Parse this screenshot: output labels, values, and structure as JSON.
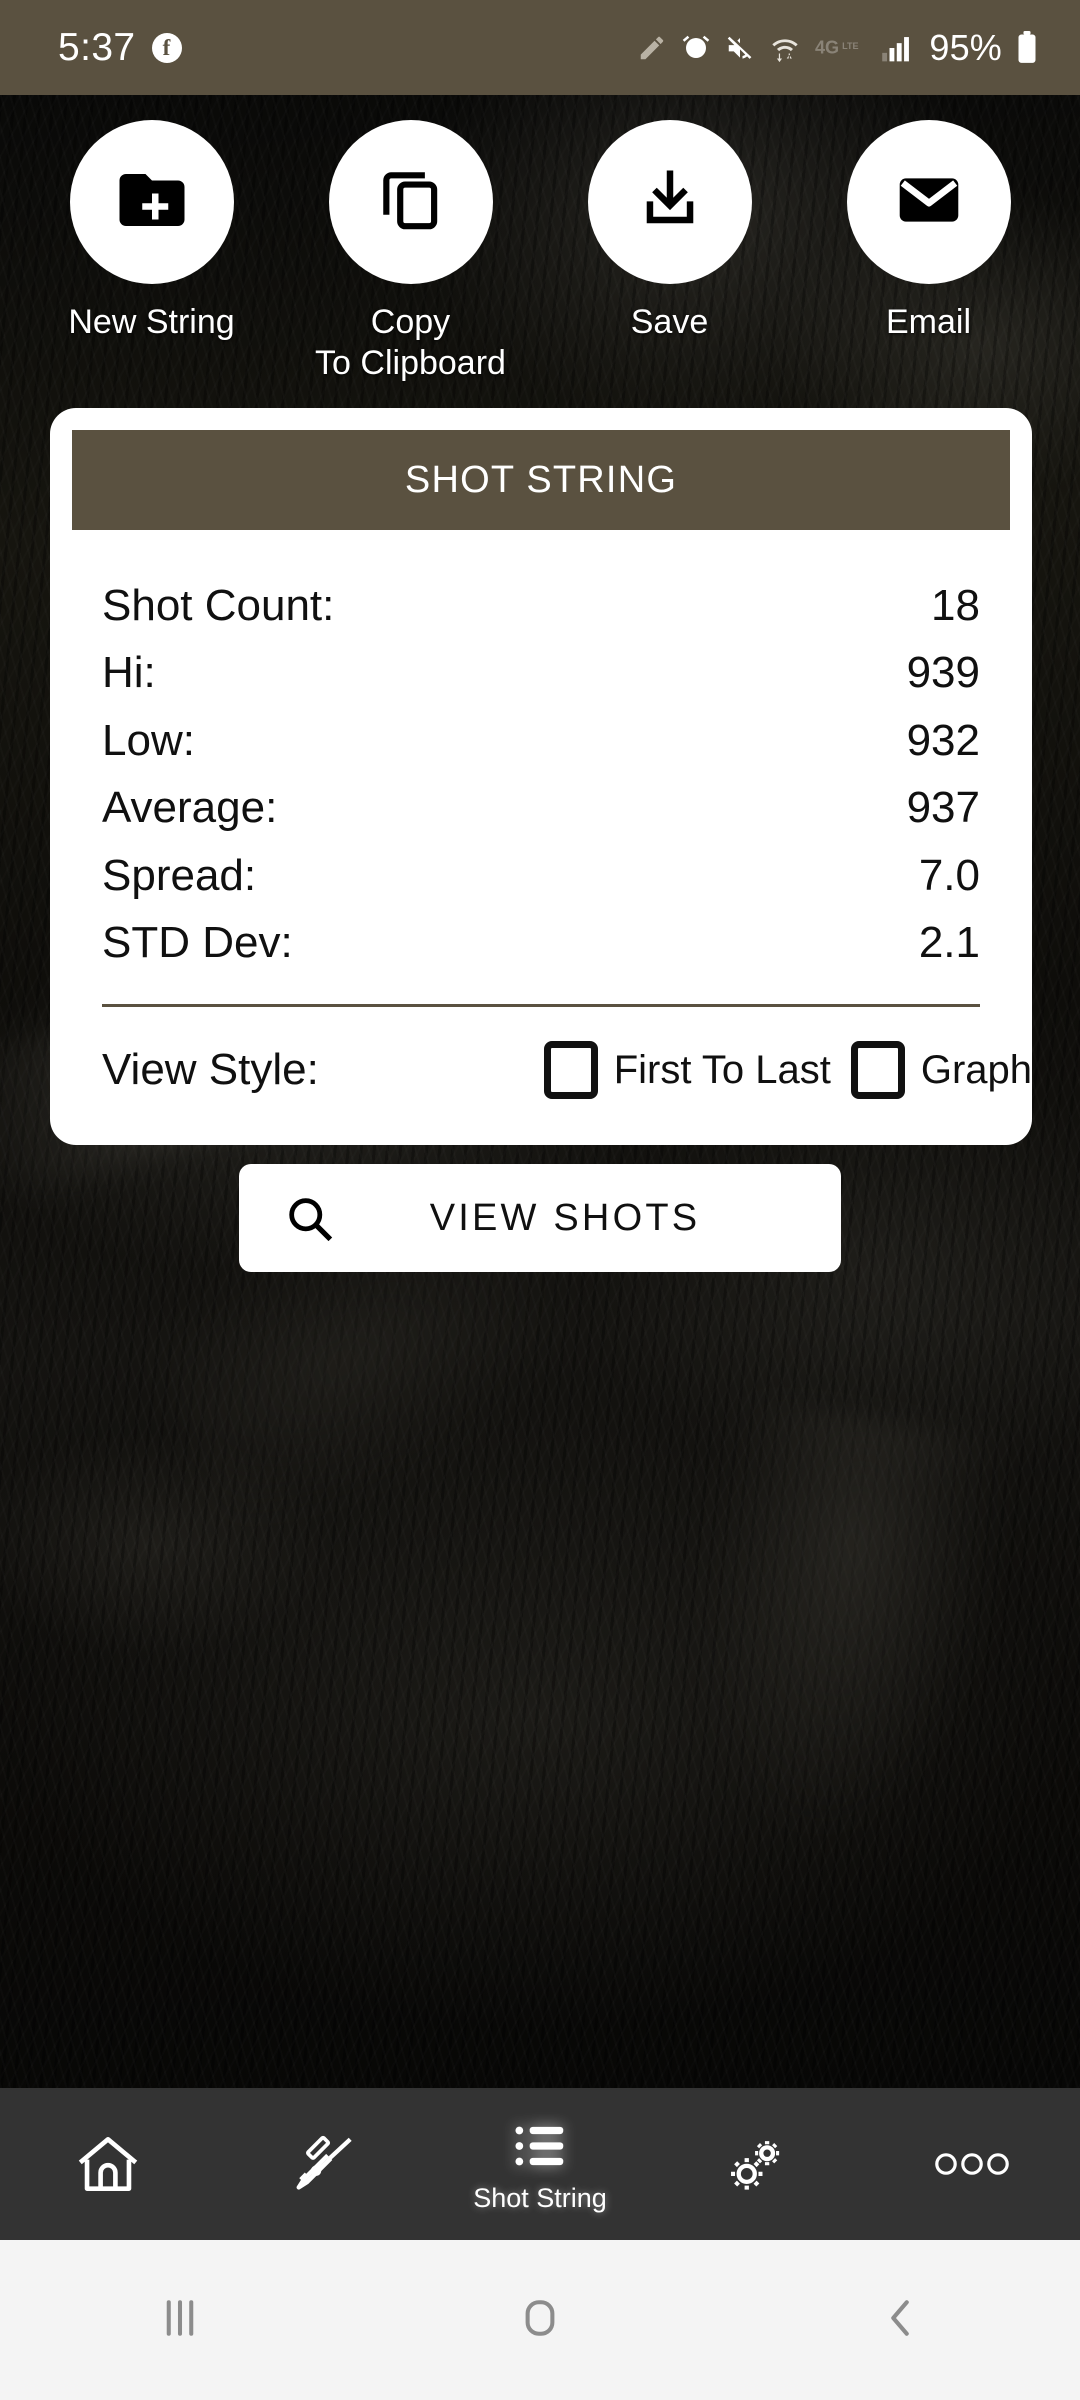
{
  "status_bar": {
    "time": "5:37",
    "battery": "95%",
    "network": "4G LTE",
    "icons": [
      "facebook-icon",
      "pencil-icon",
      "alarm-icon",
      "mute-icon",
      "wifi-icon",
      "lte-icon",
      "signal-icon",
      "battery-icon"
    ]
  },
  "actions": [
    {
      "label": "New String",
      "icon": "new-folder-icon"
    },
    {
      "label": "Copy\nTo Clipboard",
      "label_line1": "Copy",
      "label_line2": "To Clipboard",
      "icon": "copy-icon"
    },
    {
      "label": "Save",
      "icon": "download-icon"
    },
    {
      "label": "Email",
      "icon": "envelope-icon"
    }
  ],
  "card": {
    "title": "SHOT STRING",
    "stats": [
      {
        "label": "Shot Count:",
        "value": "18"
      },
      {
        "label": "Hi:",
        "value": "939"
      },
      {
        "label": "Low:",
        "value": "932"
      },
      {
        "label": "Average:",
        "value": "937"
      },
      {
        "label": "Spread:",
        "value": "7.0"
      },
      {
        "label": "STD Dev:",
        "value": "2.1"
      }
    ],
    "view_style": {
      "label": "View Style:",
      "options": [
        {
          "label": "First To Last",
          "checked": false
        },
        {
          "label": "Graph",
          "checked": false
        }
      ]
    }
  },
  "view_shots_button": {
    "label": "VIEW SHOTS",
    "icon": "search-icon"
  },
  "bottom_nav": [
    {
      "icon": "home-icon",
      "label": "",
      "active": false
    },
    {
      "icon": "rifle-icon",
      "label": "",
      "active": false
    },
    {
      "icon": "list-icon",
      "label": "Shot String",
      "active": true
    },
    {
      "icon": "gears-icon",
      "label": "",
      "active": false
    },
    {
      "icon": "more-icon",
      "label": "",
      "active": false
    }
  ],
  "system_nav": [
    {
      "icon": "recents-icon"
    },
    {
      "icon": "home-square-icon"
    },
    {
      "icon": "back-icon"
    }
  ],
  "colors": {
    "accent_brown": "#5a5140",
    "card_bg": "#ffffff",
    "nav_bg": "#333333",
    "sysnav_bg": "#f4f4f4"
  }
}
